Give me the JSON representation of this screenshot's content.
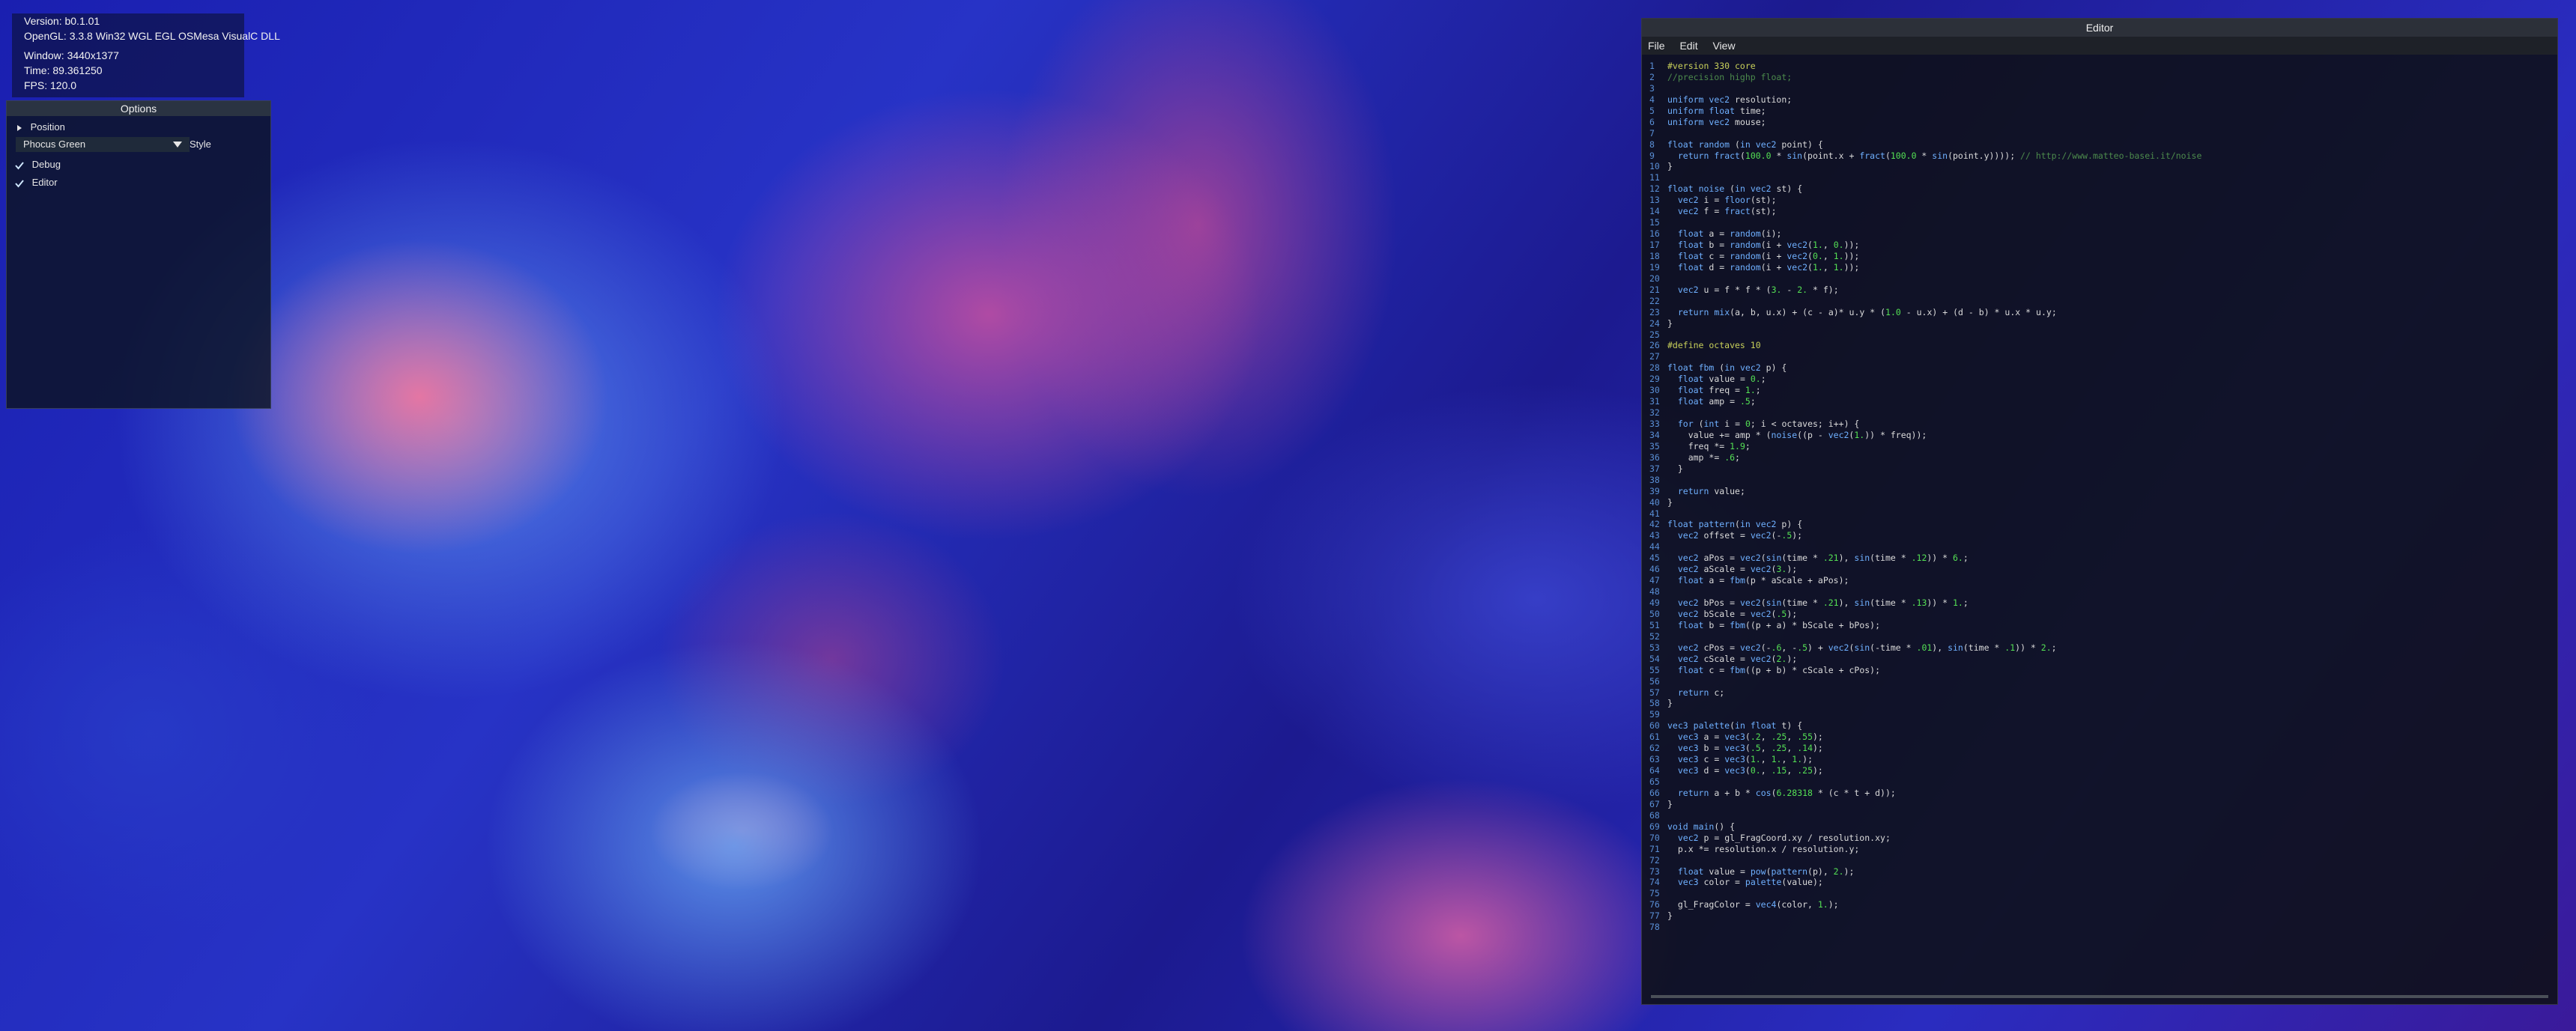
{
  "overlay": {
    "version": "Version: b0.1.01",
    "opengl": "OpenGL: 3.3.8 Win32 WGL EGL OSMesa VisualC DLL",
    "window": "Window: 3440x1377",
    "time": "Time: 89.361250",
    "fps": "FPS: 120.0"
  },
  "options": {
    "title": "Options",
    "position_label": "Position",
    "style_selected": "Phocus Green",
    "style_label": "Style",
    "debug_label": "Debug",
    "editor_label": "Editor"
  },
  "editor": {
    "title": "Editor",
    "menu": [
      "File",
      "Edit",
      "View"
    ],
    "lines": [
      "#version 330 core",
      "//precision highp float;",
      "",
      "uniform vec2 resolution;",
      "uniform float time;",
      "uniform vec2 mouse;",
      "",
      "float random (in vec2 point) {",
      "  return fract(100.0 * sin(point.x + fract(100.0 * sin(point.y)))); // http://www.matteo-basei.it/noise",
      "}",
      "",
      "float noise (in vec2 st) {",
      "  vec2 i = floor(st);",
      "  vec2 f = fract(st);",
      "",
      "  float a = random(i);",
      "  float b = random(i + vec2(1., 0.));",
      "  float c = random(i + vec2(0., 1.));",
      "  float d = random(i + vec2(1., 1.));",
      "",
      "  vec2 u = f * f * (3. - 2. * f);",
      "",
      "  return mix(a, b, u.x) + (c - a)* u.y * (1.0 - u.x) + (d - b) * u.x * u.y;",
      "}",
      "",
      "#define octaves 10",
      "",
      "float fbm (in vec2 p) {",
      "  float value = 0.;",
      "  float freq = 1.;",
      "  float amp = .5;",
      "",
      "  for (int i = 0; i < octaves; i++) {",
      "    value += amp * (noise((p - vec2(1.)) * freq));",
      "    freq *= 1.9;",
      "    amp *= .6;",
      "  }",
      "",
      "  return value;",
      "}",
      "",
      "float pattern(in vec2 p) {",
      "  vec2 offset = vec2(-.5);",
      "",
      "  vec2 aPos = vec2(sin(time * .21), sin(time * .12)) * 6.;",
      "  vec2 aScale = vec2(3.);",
      "  float a = fbm(p * aScale + aPos);",
      "",
      "  vec2 bPos = vec2(sin(time * .21), sin(time * .13)) * 1.;",
      "  vec2 bScale = vec2(.5);",
      "  float b = fbm((p + a) * bScale + bPos);",
      "",
      "  vec2 cPos = vec2(-.6, -.5) + vec2(sin(-time * .01), sin(time * .1)) * 2.;",
      "  vec2 cScale = vec2(2.);",
      "  float c = fbm((p + b) * cScale + cPos);",
      "",
      "  return c;",
      "}",
      "",
      "vec3 palette(in float t) {",
      "  vec3 a = vec3(.2, .25, .55);",
      "  vec3 b = vec3(.5, .25, .14);",
      "  vec3 c = vec3(1., 1., 1.);",
      "  vec3 d = vec3(0., .15, .25);",
      "",
      "  return a + b * cos(6.28318 * (c * t + d));",
      "}",
      "",
      "void main() {",
      "  vec2 p = gl_FragCoord.xy / resolution.xy;",
      "  p.x *= resolution.x / resolution.y;",
      "",
      "  float value = pow(pattern(p), 2.);",
      "  vec3 color = palette(value);",
      "",
      "  gl_FragColor = vec4(color, 1.);",
      "}",
      ""
    ]
  },
  "colors": {
    "panel_title_bg": "#2a3342",
    "editor_bg": "#0e1016",
    "line_number": "#5a8fd6",
    "keyword": "#6fb0ff",
    "preprocessor": "#c8d05a",
    "comment": "#4c8a4c",
    "number": "#54e054",
    "text": "#dadada",
    "checkmark": "#cfe7ff"
  }
}
